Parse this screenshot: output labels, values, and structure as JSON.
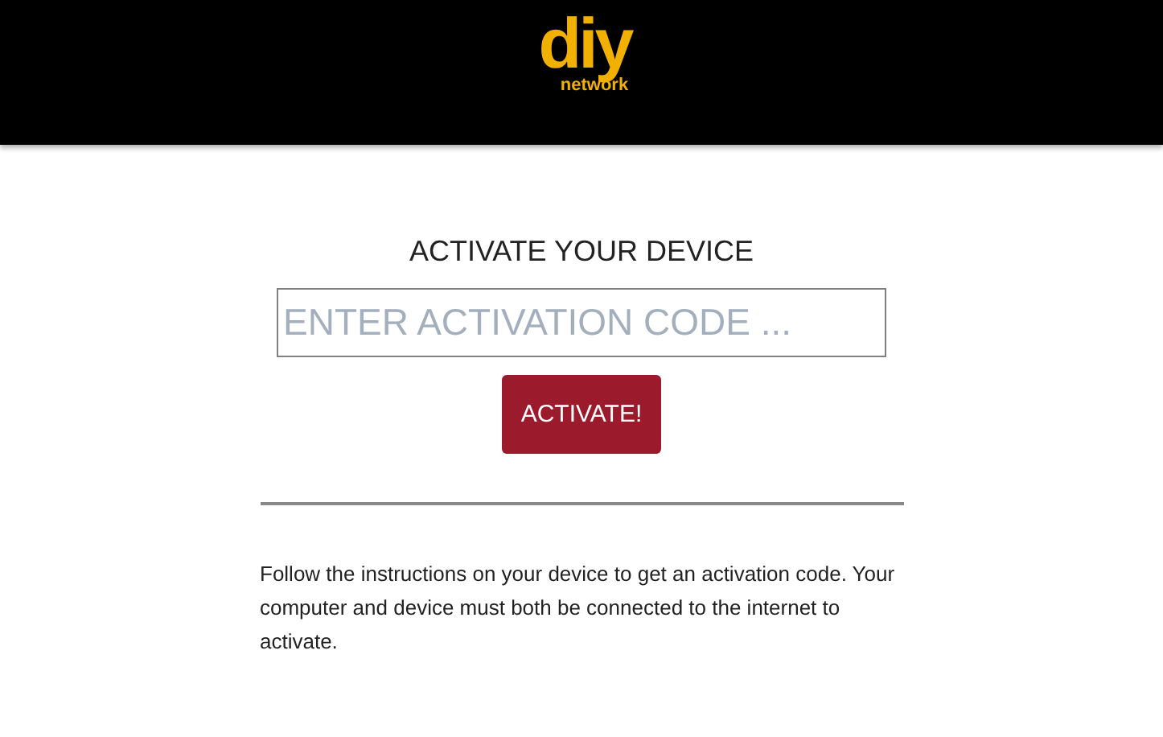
{
  "header": {
    "logo": {
      "main": "diy",
      "sub": "network"
    }
  },
  "title": "ACTIVATE YOUR DEVICE",
  "code_field": {
    "placeholder": "ENTER ACTIVATION CODE ..."
  },
  "activate_button": "ACTIVATE!",
  "instructions": "Follow the instructions on your device to get an activation code. Your computer and device must both be connected to the internet to activate."
}
